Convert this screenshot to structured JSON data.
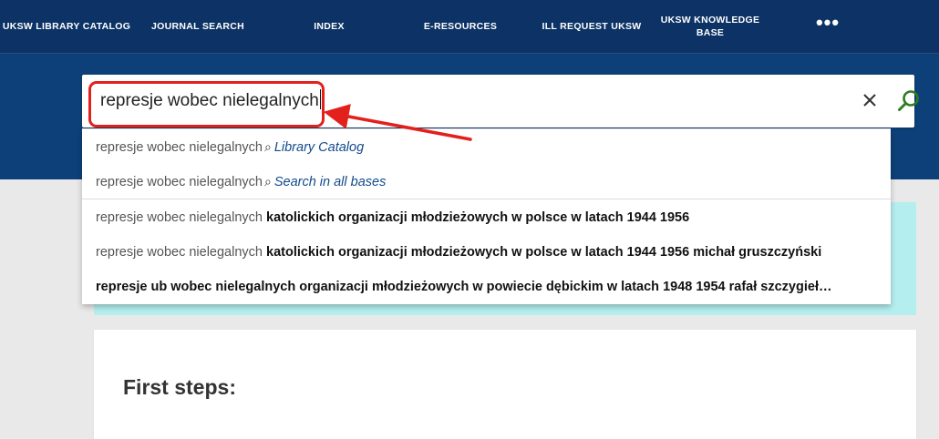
{
  "nav": {
    "items": [
      {
        "label": "UKSW LIBRARY CATALOG"
      },
      {
        "label": "JOURNAL SEARCH"
      },
      {
        "label": "INDEX"
      },
      {
        "label": "E-RESOURCES"
      },
      {
        "label": "ILL REQUEST UKSW"
      },
      {
        "label": "UKSW KNOWLEDGE BASE"
      }
    ],
    "more_label": "•••"
  },
  "search": {
    "value": "represje wobec nielegalnych",
    "clear_icon": "close-icon",
    "submit_icon": "search-icon"
  },
  "suggestions": {
    "scoped": [
      {
        "query": "represje wobec nielegalnych",
        "scope": "Library Catalog"
      },
      {
        "query": "represje wobec nielegalnych",
        "scope": "Search in all bases"
      }
    ],
    "terms": [
      {
        "prefix": "represje wobec nielegalnych ",
        "completion": "katolickich organizacji młodzieżowych w polsce w latach 1944 1956"
      },
      {
        "prefix": "represje wobec nielegalnych ",
        "completion": "katolickich organizacji młodzieżowych w polsce w latach 1944 1956 michał gruszczyński"
      },
      {
        "prefix": "",
        "completion": "represje ub wobec nielegalnych organizacji młodzieżowych w powiecie dębickim w latach 1948 1954 rafał szczygieł…"
      }
    ]
  },
  "content": {
    "first_steps_title": "First steps:"
  },
  "colors": {
    "nav_bg": "#0d3366",
    "hero_bg": "#0d4078",
    "annotation": "#e3201b",
    "search_icon": "#2e7d1e",
    "alert_bg": "#b5eeee"
  }
}
